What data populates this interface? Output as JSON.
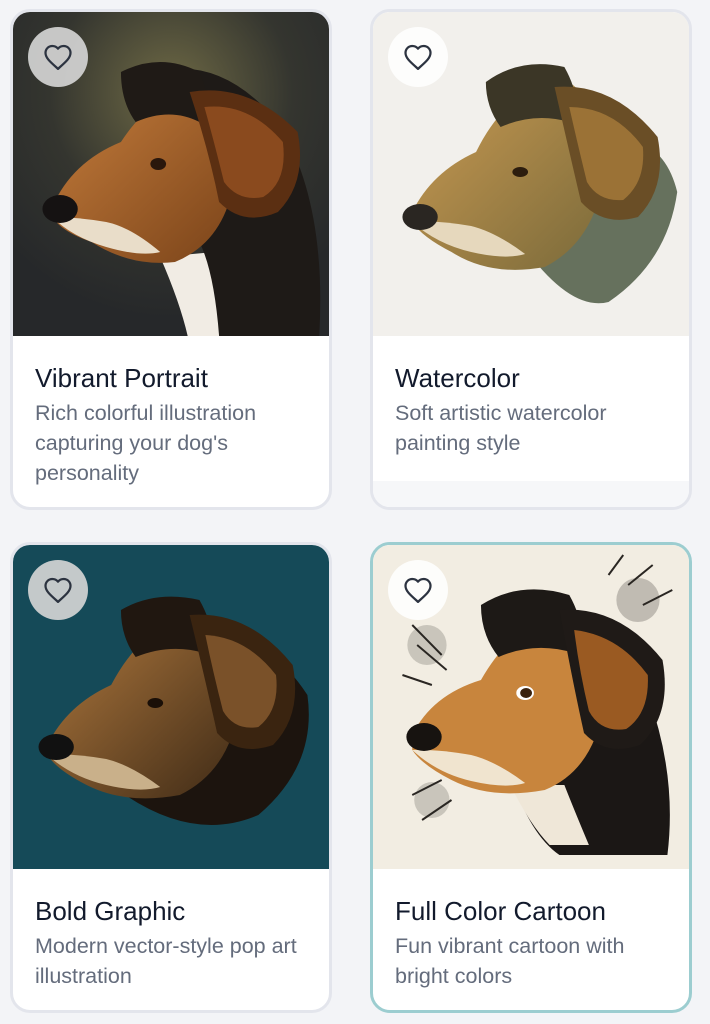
{
  "styles": [
    {
      "title": "Vibrant Portrait",
      "description": "Rich colorful illustration capturing your dog's personality",
      "image": "beagle-vibrant-portrait",
      "favorite_icon": "heart-outline-icon",
      "selected": false
    },
    {
      "title": "Watercolor",
      "description": "Soft artistic watercolor painting style",
      "image": "beagle-watercolor",
      "favorite_icon": "heart-outline-icon",
      "selected": false
    },
    {
      "title": "Bold Graphic",
      "description": "Modern vector-style pop art illustration",
      "image": "beagle-bold-graphic",
      "favorite_icon": "heart-outline-icon",
      "selected": false
    },
    {
      "title": "Full Color Cartoon",
      "description": "Fun vibrant cartoon with bright colors",
      "image": "beagle-full-color-cartoon",
      "favorite_icon": "heart-outline-icon",
      "selected": true
    }
  ],
  "colors": {
    "selected_border": "#9ccdd0",
    "card_border": "#e3e5ec",
    "title_text": "#121a2c",
    "desc_text": "#646c7c",
    "portrait_bg": "#2b2d2e",
    "watercolor_bg": "#f2f0ec",
    "bold_graphic_bg": "#154a58",
    "cartoon_bg": "#f2ede2"
  }
}
